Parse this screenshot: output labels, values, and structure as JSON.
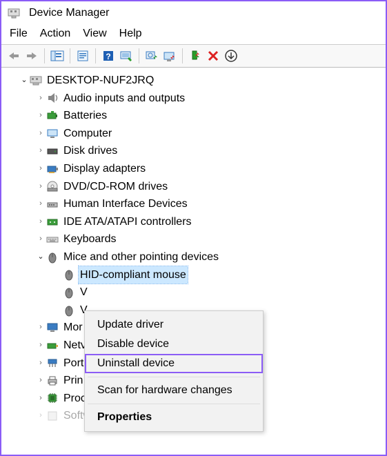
{
  "window": {
    "title": "Device Manager"
  },
  "menu": {
    "file": "File",
    "action": "Action",
    "view": "View",
    "help": "Help"
  },
  "tree": {
    "root": "DESKTOP-NUF2JRQ",
    "nodes": {
      "audio": "Audio inputs and outputs",
      "batteries": "Batteries",
      "computer": "Computer",
      "diskdrives": "Disk drives",
      "display": "Display adapters",
      "dvd": "DVD/CD-ROM drives",
      "hid": "Human Interface Devices",
      "ide": "IDE ATA/ATAPI controllers",
      "keyboards": "Keyboards",
      "mice": "Mice and other pointing devices",
      "mice_children": {
        "hidmouse": "HID-compliant mouse",
        "v1": "V",
        "v2": "V"
      },
      "monitors": "Mor",
      "network": "Netv",
      "ports": "Port",
      "printqueues": "Prin",
      "processors": "Proc",
      "software": "Software devices"
    }
  },
  "context_menu": {
    "update": "Update driver",
    "disable": "Disable device",
    "uninstall": "Uninstall device",
    "scan": "Scan for hardware changes",
    "properties": "Properties"
  }
}
